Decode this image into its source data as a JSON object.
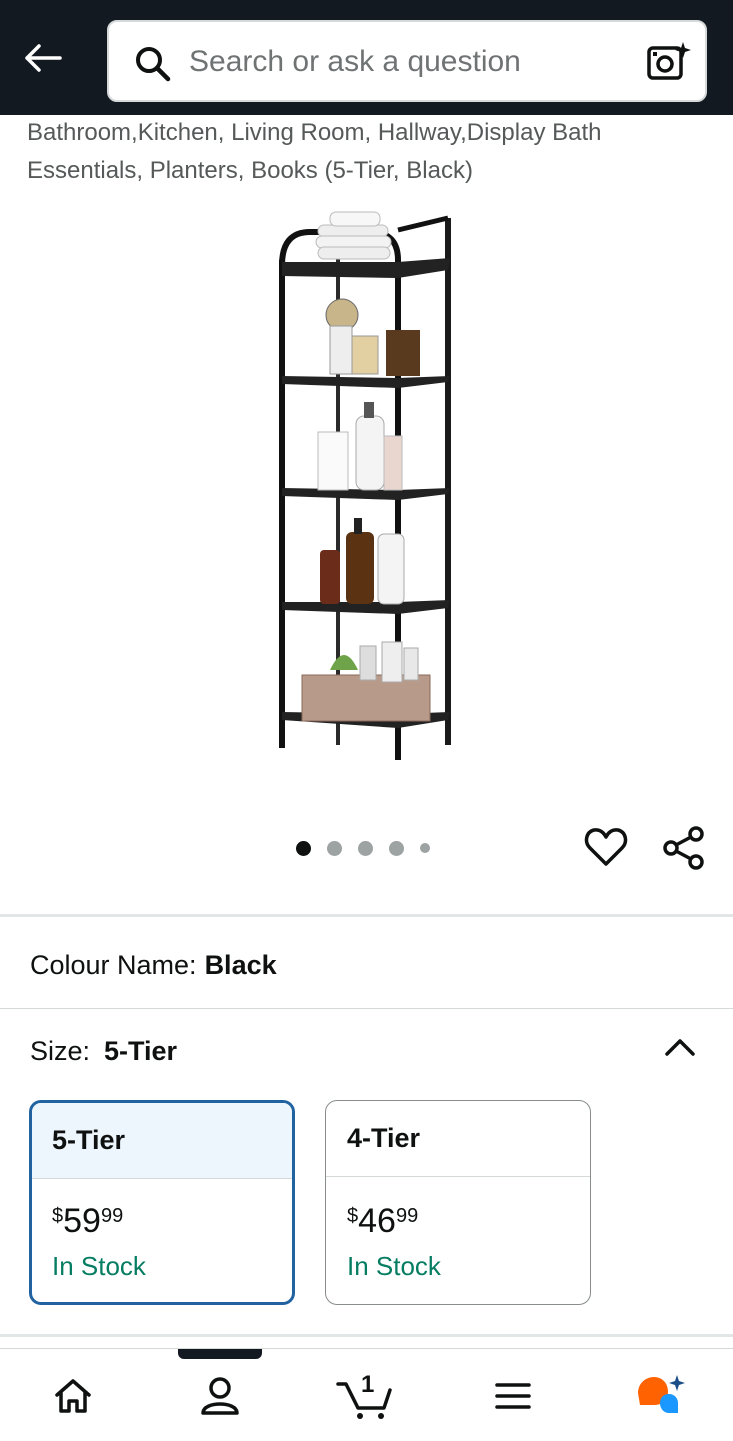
{
  "header": {
    "search_placeholder": "Search or ask a question",
    "icons": [
      "back-arrow-icon",
      "search-icon",
      "camera-sparkle-icon"
    ]
  },
  "product": {
    "title_partial": "Bathroom,Kitchen, Living Room, Hallway,Display Bath Essentials, Planters, Books (5-Tier, Black)",
    "image_count": 5,
    "active_image": 1
  },
  "options": {
    "colour_label": "Colour Name:",
    "colour_value": "Black",
    "size_label": "Size:",
    "size_value": "5-Tier"
  },
  "sizes": [
    {
      "name": "5-Tier",
      "currency": "$",
      "whole": "59",
      "fraction": "99",
      "stock": "In Stock",
      "selected": true
    },
    {
      "name": "4-Tier",
      "currency": "$",
      "whole": "46",
      "fraction": "99",
      "stock": "In Stock",
      "selected": false
    }
  ],
  "bottom_nav": {
    "cart_count": "1",
    "items": [
      "home-icon",
      "account-icon",
      "cart-icon",
      "menu-icon",
      "rufus-ai-icon"
    ]
  },
  "colors": {
    "header_bg": "#131921",
    "selected_border": "#2162a1",
    "in_stock": "#067d62",
    "rufus_orange": "#ff6200",
    "rufus_blue": "#1a98ff"
  }
}
